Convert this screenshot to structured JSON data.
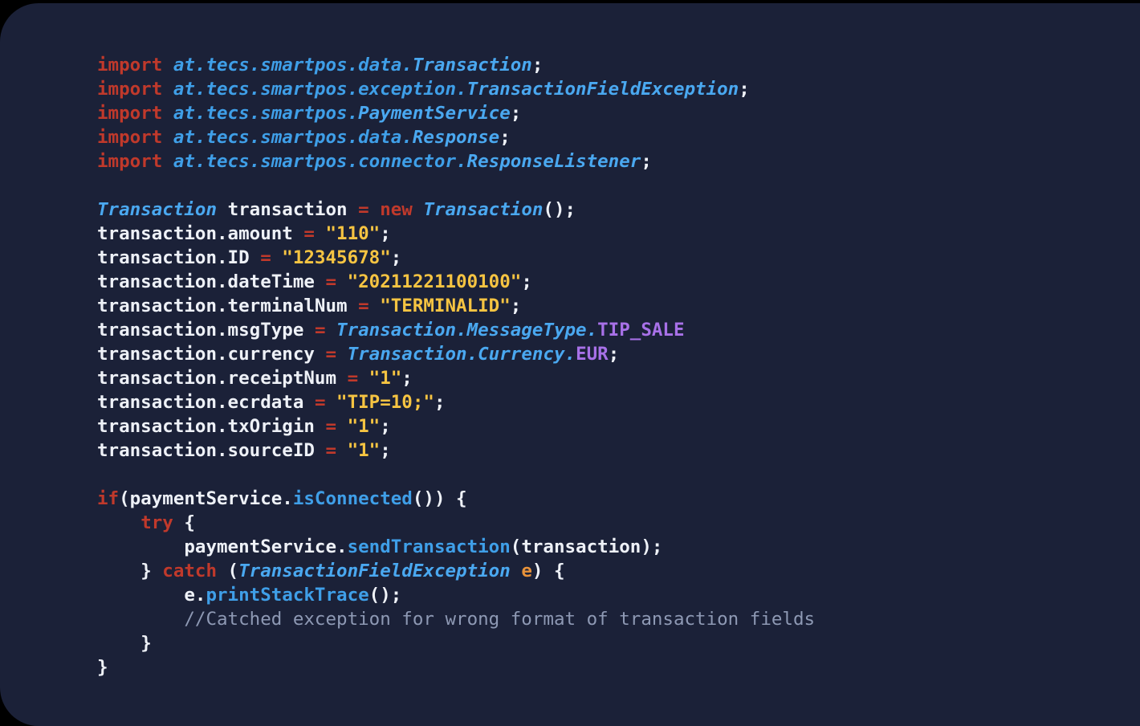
{
  "card": {
    "name": "code-snippet-card",
    "background_color": "#1b2138",
    "outside_color": "#000000",
    "corner_radius_px": 48,
    "language": "Java"
  },
  "palette": {
    "keyword": "#c0392b",
    "package": "#3f9fe8",
    "type": "#4aa8f0",
    "plain_text": "#eef1f7",
    "string": "#f6c442",
    "operator": "#c0392b",
    "method": "#3f9fe8",
    "constant": "#a871e8",
    "variable": "#e8923a",
    "comment": "#8e99b4"
  },
  "code": {
    "imports": [
      {
        "keyword": "import",
        "package": "at.tecs.smartpos.data.",
        "class": "Transaction",
        "terminator": ";"
      },
      {
        "keyword": "import",
        "package": "at.tecs.smartpos.exception.",
        "class": "TransactionFieldException",
        "terminator": ";"
      },
      {
        "keyword": "import",
        "package": "at.tecs.smartpos.",
        "class": "PaymentService",
        "terminator": ";"
      },
      {
        "keyword": "import",
        "package": "at.tecs.smartpos.data.",
        "class": "Response",
        "terminator": ";"
      },
      {
        "keyword": "import",
        "package": "at.tecs.smartpos.connector.",
        "class": "ResponseListener",
        "terminator": ";"
      }
    ],
    "declaration": {
      "type": "Transaction",
      "variable": "transaction",
      "operator": "=",
      "keyword_new": "new",
      "constructor": "Transaction",
      "parens": "();"
    },
    "assignments": [
      {
        "target": "transaction.amount",
        "operator": "=",
        "value": "\"110\"",
        "value_kind": "string",
        "terminator": ";"
      },
      {
        "target": "transaction.ID",
        "operator": "=",
        "value": "\"12345678\"",
        "value_kind": "string",
        "terminator": ";"
      },
      {
        "target": "transaction.dateTime",
        "operator": "=",
        "value": "\"20211221100100\"",
        "value_kind": "string",
        "terminator": ";"
      },
      {
        "target": "transaction.terminalNum",
        "operator": "=",
        "value": "\"TERMINALID\"",
        "value_kind": "string",
        "terminator": ";"
      },
      {
        "target": "transaction.msgType",
        "operator": "=",
        "enum_type": "Transaction.MessageType.",
        "constant": "TIP_SALE",
        "value_kind": "enum",
        "terminator": ""
      },
      {
        "target": "transaction.currency",
        "operator": "=",
        "enum_type": "Transaction.Currency.",
        "constant": "EUR",
        "value_kind": "enum",
        "terminator": ";"
      },
      {
        "target": "transaction.receiptNum",
        "operator": "=",
        "value": "\"1\"",
        "value_kind": "string",
        "terminator": ";"
      },
      {
        "target": "transaction.ecrdata",
        "operator": "=",
        "value": "\"TIP=10;\"",
        "value_kind": "string",
        "terminator": ";"
      },
      {
        "target": "transaction.txOrigin",
        "operator": "=",
        "value": "\"1\"",
        "value_kind": "string",
        "terminator": ";"
      },
      {
        "target": "transaction.sourceID",
        "operator": "=",
        "value": "\"1\"",
        "value_kind": "string",
        "terminator": ";"
      }
    ],
    "block": {
      "if_keyword": "if",
      "if_condition_object": "(paymentService.",
      "if_condition_method": "isConnected",
      "if_condition_tail": "()) {",
      "try_keyword": "try",
      "try_brace": " {",
      "send_object": "paymentService.",
      "send_method": "sendTransaction",
      "send_args": "(transaction);",
      "catch_close_brace": "} ",
      "catch_keyword": "catch",
      "catch_open": " (",
      "catch_type": "TransactionFieldException",
      "catch_var": "e",
      "catch_tail": ") {",
      "print_object": "e.",
      "print_method": "printStackTrace",
      "print_tail": "();",
      "comment": "//Catched exception for wrong format of transaction fields",
      "close_inner": "}",
      "close_outer": "}"
    }
  }
}
